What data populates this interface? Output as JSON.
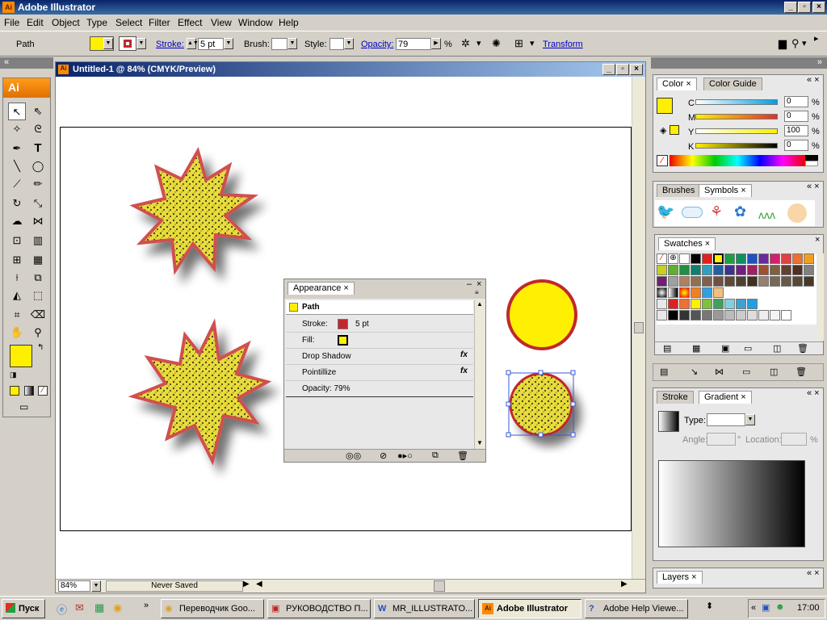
{
  "window": {
    "title": "Adobe Illustrator",
    "min": "_",
    "max": "▫",
    "close": "×"
  },
  "menu": [
    "File",
    "Edit",
    "Object",
    "Type",
    "Select",
    "Filter",
    "Effect",
    "View",
    "Window",
    "Help"
  ],
  "control": {
    "selection": "Path",
    "stroke_label": "Stroke:",
    "stroke_value": "5 pt",
    "brush_label": "Brush:",
    "style_label": "Style:",
    "opacity_label": "Opacity:",
    "opacity_value": "79",
    "percent": "%",
    "transform": "Transform"
  },
  "colors": {
    "fill": "#ffef00",
    "stroke": "#c0282d",
    "accent": "#0a246a"
  },
  "document": {
    "title": "Untitled-1 @ 84% (CMYK/Preview)",
    "zoom": "84%",
    "status": "Never Saved"
  },
  "appearance": {
    "tab": "Appearance",
    "target": "Path",
    "rows": [
      {
        "label": "Stroke:",
        "value": "5 pt",
        "fx": ""
      },
      {
        "label": "Fill:",
        "value": "",
        "fx": ""
      },
      {
        "label": "Drop Shadow",
        "value": "",
        "fx": "fx"
      },
      {
        "label": "Pointillize",
        "value": "",
        "fx": "fx"
      },
      {
        "label": "Opacity: 79%",
        "value": "",
        "fx": ""
      }
    ]
  },
  "color_panel": {
    "tabs": [
      "Color",
      "Color Guide"
    ],
    "channels": [
      {
        "label": "C",
        "value": "0"
      },
      {
        "label": "M",
        "value": "0"
      },
      {
        "label": "Y",
        "value": "100"
      },
      {
        "label": "K",
        "value": "0"
      }
    ],
    "percent": "%"
  },
  "brushes_panel": {
    "tabs": [
      "Brushes",
      "Symbols"
    ]
  },
  "swatches_panel": {
    "tab": "Swatches"
  },
  "gradient_panel": {
    "tabs": [
      "Stroke",
      "Gradient"
    ],
    "type_label": "Type:",
    "angle_label": "Angle:",
    "location_label": "Location:",
    "degree": "°",
    "percent": "%"
  },
  "layers_panel": {
    "tab": "Layers"
  },
  "taskbar": {
    "start": "Пуск",
    "buttons": [
      {
        "label": "Переводчик Goo...",
        "active": false
      },
      {
        "label": "РУКОВОДСТВО П...",
        "active": false
      },
      {
        "label": "MR_ILLUSTRATO...",
        "active": false
      },
      {
        "label": "Adobe Illustrator",
        "active": true
      },
      {
        "label": "Adobe Help Viewe...",
        "active": false
      }
    ],
    "clock": "17:00"
  }
}
